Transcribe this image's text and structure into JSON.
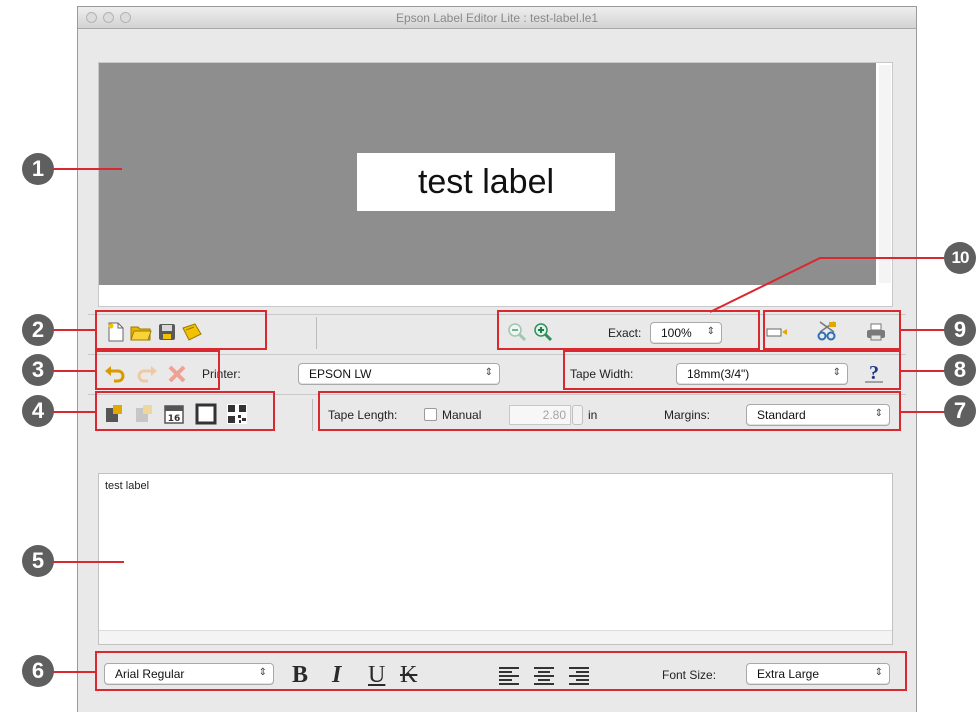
{
  "window": {
    "title": "Epson Label Editor Lite : test-label.le1"
  },
  "preview": {
    "label_text": "test label"
  },
  "toolbar1": {
    "file_icons": [
      "new-document-icon",
      "open-folder-icon",
      "save-disk-icon",
      "save-as-icon"
    ],
    "zoom_out_icon": "zoom-out-icon",
    "zoom_in_icon": "zoom-in-icon",
    "zoom_label": "Exact:",
    "zoom_value": "100%",
    "print_icons": [
      "tape-feed-icon",
      "cut-scissors-icon",
      "printer-icon"
    ]
  },
  "toolbar2": {
    "edit_icons": [
      "undo-icon",
      "redo-icon",
      "delete-icon"
    ],
    "printer_label": "Printer:",
    "printer_value": "EPSON LW",
    "tape_width_label": "Tape Width:",
    "tape_width_value": "18mm(3/4\")",
    "help_icon": "help-icon"
  },
  "toolbar3": {
    "insert_icons": [
      "insert-symbol-icon",
      "insert-graphic-icon",
      "insert-date-icon",
      "insert-frame-icon",
      "insert-qr-icon"
    ],
    "tape_length_label": "Tape Length:",
    "manual_label": "Manual",
    "manual_checked": false,
    "length_value": "2.80",
    "length_unit": "in",
    "margins_label": "Margins:",
    "margins_value": "Standard"
  },
  "editor": {
    "text": "test label"
  },
  "format_bar": {
    "font_value": "Arial Regular",
    "bold": "B",
    "italic": "I",
    "underline": "U",
    "strike": "K",
    "align_icons": [
      "align-left-icon",
      "align-center-icon",
      "align-right-icon"
    ],
    "font_size_label": "Font Size:",
    "font_size_value": "Extra Large"
  },
  "callouts": [
    "1",
    "2",
    "3",
    "4",
    "5",
    "6",
    "7",
    "8",
    "9",
    "10"
  ],
  "colors": {
    "callout_red": "#d9282f",
    "callout_circle": "#5f5f5f",
    "preview_gray": "#8e8e8e"
  }
}
